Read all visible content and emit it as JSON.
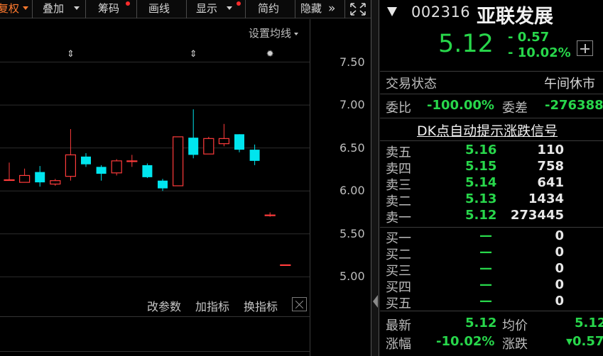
{
  "toolbar": {
    "items": [
      {
        "label": "复权",
        "has_dropdown": true,
        "has_dot": false
      },
      {
        "label": "叠加",
        "has_dropdown": true,
        "has_dot": false
      },
      {
        "label": "筹码",
        "has_dropdown": false,
        "has_dot": true
      },
      {
        "label": "画线",
        "has_dropdown": false,
        "has_dot": false
      },
      {
        "label": "显示",
        "has_dropdown": true,
        "has_dot": true
      },
      {
        "label": "简约",
        "has_dropdown": false,
        "has_dot": false
      },
      {
        "label": "隐藏",
        "has_dropdown": false,
        "has_dot": false
      }
    ],
    "more_glyph": "»",
    "fullscreen_icon": "fullscreen-icon"
  },
  "chart": {
    "ma_setting_label": "设置均线",
    "up_color": "#ff3b3b",
    "down_color": "#00e5ee",
    "bottom_links": [
      "改参数",
      "加指标",
      "换指标"
    ],
    "close_icon": "close-icon"
  },
  "chart_data": {
    "type": "candlestick",
    "y_ticks": [
      "7.50",
      "7.00",
      "6.50",
      "6.00",
      "5.50",
      "5.00"
    ],
    "ylim": [
      4.78,
      8.0
    ],
    "candles": [
      {
        "open": 6.13,
        "close": 6.13,
        "high": 6.33,
        "low": 6.13
      },
      {
        "open": 6.1,
        "close": 6.18,
        "high": 6.26,
        "low": 6.1
      },
      {
        "open": 6.22,
        "close": 6.1,
        "high": 6.29,
        "low": 6.05
      },
      {
        "open": 6.08,
        "close": 6.12,
        "high": 6.14,
        "low": 6.06
      },
      {
        "open": 6.17,
        "close": 6.42,
        "high": 6.72,
        "low": 6.12
      },
      {
        "open": 6.4,
        "close": 6.31,
        "high": 6.44,
        "low": 6.28
      },
      {
        "open": 6.28,
        "close": 6.2,
        "high": 6.3,
        "low": 6.12
      },
      {
        "open": 6.21,
        "close": 6.35,
        "high": 6.37,
        "low": 6.18
      },
      {
        "open": 6.35,
        "close": 6.35,
        "high": 6.42,
        "low": 6.28
      },
      {
        "open": 6.3,
        "close": 6.16,
        "high": 6.32,
        "low": 6.15
      },
      {
        "open": 6.12,
        "close": 6.03,
        "high": 6.14,
        "low": 6.0
      },
      {
        "open": 6.06,
        "close": 6.63,
        "high": 6.63,
        "low": 6.06
      },
      {
        "open": 6.62,
        "close": 6.42,
        "high": 6.95,
        "low": 6.38
      },
      {
        "open": 6.43,
        "close": 6.61,
        "high": 6.63,
        "low": 6.43
      },
      {
        "open": 6.55,
        "close": 6.61,
        "high": 6.78,
        "low": 6.52
      },
      {
        "open": 6.66,
        "close": 6.48,
        "high": 6.66,
        "low": 6.45
      },
      {
        "open": 6.48,
        "close": 6.35,
        "high": 6.54,
        "low": 6.3
      },
      {
        "open": 5.72,
        "close": 5.72,
        "high": 5.75,
        "low": 5.7
      },
      {
        "open": 5.14,
        "close": 5.14,
        "high": 5.14,
        "low": 5.14
      }
    ],
    "markers": [
      {
        "candle": 4,
        "icon": "event-arrows-icon"
      },
      {
        "candle": 12,
        "icon": "event-arrows-icon"
      },
      {
        "candle": 17,
        "icon": "sun-icon"
      }
    ]
  },
  "quote": {
    "code": "002316",
    "name": "亚联发展",
    "last": "5.12",
    "change": "- 0.57",
    "change_pct": "- 10.02%",
    "status_label": "交易状态",
    "status_value": "午间休市",
    "weibi_label": "委比",
    "weibi_value": "-100.00%",
    "weicha_label": "委差",
    "weicha_value": "-276388",
    "dk_signal": "DK点自动提示涨跌信号",
    "sells": [
      {
        "label": "卖五",
        "price": "5.16",
        "volume": "110"
      },
      {
        "label": "卖四",
        "price": "5.15",
        "volume": "758"
      },
      {
        "label": "卖三",
        "price": "5.14",
        "volume": "641"
      },
      {
        "label": "卖二",
        "price": "5.13",
        "volume": "1434"
      },
      {
        "label": "卖一",
        "price": "5.12",
        "volume": "273445"
      }
    ],
    "buys": [
      {
        "label": "买一",
        "price": "—",
        "volume": "0"
      },
      {
        "label": "买二",
        "price": "—",
        "volume": "0"
      },
      {
        "label": "买三",
        "price": "—",
        "volume": "0"
      },
      {
        "label": "买四",
        "price": "—",
        "volume": "0"
      },
      {
        "label": "买五",
        "price": "—",
        "volume": "0"
      }
    ],
    "latest_label": "最新",
    "latest_value": "5.12",
    "avg_label": "均价",
    "avg_value": "5.12",
    "pct_label": "涨幅",
    "pct_value": "-10.02%",
    "chg_label": "涨跌",
    "chg_value": "▾0.57"
  }
}
